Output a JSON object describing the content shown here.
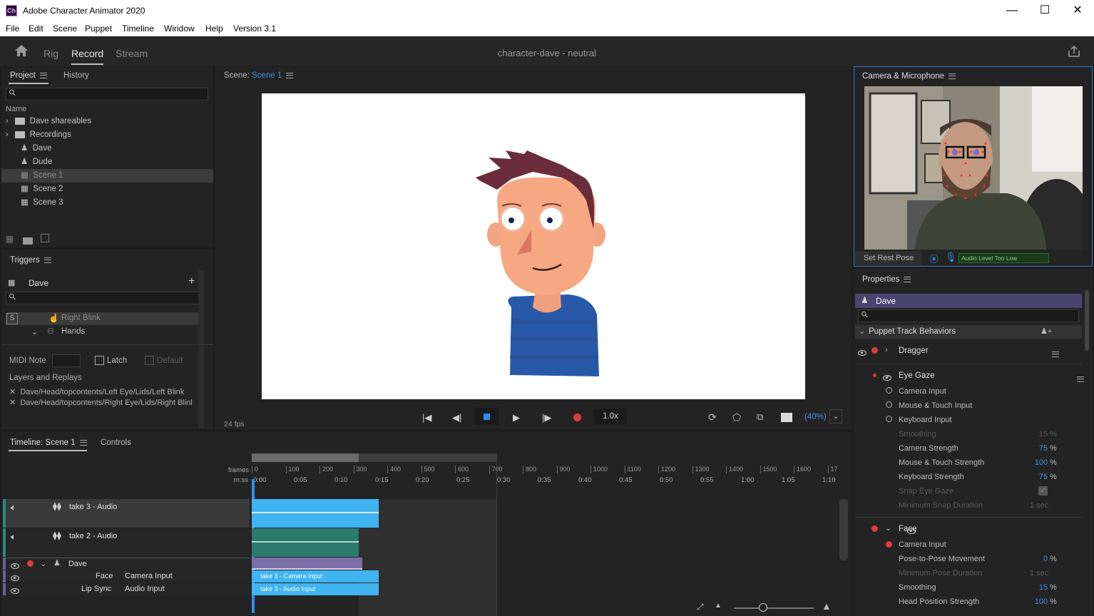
{
  "window": {
    "app_icon": "Ch",
    "title": "Adobe Character Animator 2020"
  },
  "menu": [
    "File",
    "Edit",
    "Scene",
    "Puppet",
    "Timeline",
    "Window",
    "Help",
    "Version 3.1"
  ],
  "workspace": {
    "tabs": [
      "Rig",
      "Record",
      "Stream"
    ],
    "active_tab": "Record",
    "document_title": "character-dave - neutral"
  },
  "project": {
    "tabs": [
      "Project",
      "History"
    ],
    "column_header": "Name",
    "items": [
      {
        "label": "Dave shareables",
        "type": "folder",
        "expandable": true
      },
      {
        "label": "Recordings",
        "type": "folder",
        "expandable": true
      },
      {
        "label": "Dave",
        "type": "puppet"
      },
      {
        "label": "Dude",
        "type": "puppet"
      },
      {
        "label": "Scene 1",
        "type": "scene",
        "selected": true
      },
      {
        "label": "Scene 2",
        "type": "scene"
      },
      {
        "label": "Scene 3",
        "type": "scene"
      }
    ]
  },
  "triggers": {
    "title": "Triggers",
    "puppet": "Dave",
    "items": [
      {
        "key": "S",
        "label": "Right Blink"
      },
      {
        "label": "Hands"
      }
    ],
    "midi_note_label": "MIDI Note",
    "latch_label": "Latch",
    "default_label": "Default",
    "layers_title": "Layers and Replays",
    "layers": [
      "Dave/Head/topcontents/Left Eye/Lids/Left Blink",
      "Dave/Head/topcontents/Right Eye/Lids/Right Blinl"
    ]
  },
  "scene": {
    "label": "Scene:",
    "name": "Scene 1",
    "fps": "24 fps",
    "speed": "1.0x",
    "zoom": "(40%)"
  },
  "camera": {
    "title": "Camera & Microphone",
    "set_rest_pose": "Set Rest Pose",
    "audio_level": "Audio Level Too Low"
  },
  "properties": {
    "title": "Properties",
    "puppet": "Dave",
    "section": "Puppet Track Behaviors",
    "behaviors": [
      {
        "name": "Dragger",
        "expanded": false
      },
      {
        "name": "Eye Gaze",
        "expanded": true,
        "inputs": [
          "Camera Input",
          "Mouse & Touch Input",
          "Keyboard Input"
        ],
        "params": [
          {
            "label": "Smoothing",
            "value": "15",
            "unit": "%",
            "disabled": true
          },
          {
            "label": "Camera Strength",
            "value": "75",
            "unit": "%"
          },
          {
            "label": "Mouse & Touch Strength",
            "value": "100",
            "unit": "%"
          },
          {
            "label": "Keyboard Strength",
            "value": "75",
            "unit": "%"
          },
          {
            "label": "Snap Eye Gaze",
            "value": "",
            "unit": "",
            "disabled": true,
            "checkbox": true
          },
          {
            "label": "Minimum Snap Duration",
            "value": "1",
            "unit": "sec",
            "disabled": true
          }
        ]
      },
      {
        "name": "Face",
        "expanded": true,
        "inputs": [
          "Camera Input"
        ],
        "params": [
          {
            "label": "Pose-to-Pose Movement",
            "value": "0",
            "unit": "%"
          },
          {
            "label": "Minimum Pose Duration",
            "value": "1",
            "unit": "sec",
            "disabled": true
          },
          {
            "label": "Smoothing",
            "value": "15",
            "unit": "%"
          },
          {
            "label": "Head Position Strength",
            "value": "100",
            "unit": "%"
          }
        ]
      }
    ]
  },
  "timeline": {
    "tabs": [
      "Timeline: Scene 1",
      "Controls"
    ],
    "frames_label": "frames",
    "mss_label": "m:ss",
    "frame_ticks": [
      "0",
      "100",
      "200",
      "300",
      "400",
      "500",
      "600",
      "700",
      "800",
      "900",
      "1000",
      "1100",
      "1200",
      "1300",
      "1400",
      "1500",
      "1600",
      "17"
    ],
    "time_ticks": [
      "0:00",
      "0:05",
      "0:10",
      "0:15",
      "0:20",
      "0:25",
      "0:30",
      "0:35",
      "0:40",
      "0:45",
      "0:50",
      "0:55",
      "1:00",
      "1:05",
      "1:10"
    ],
    "tracks": [
      {
        "label": "take 3 - Audio"
      },
      {
        "label": "take 2 - Audio"
      }
    ],
    "puppet_track": "Dave",
    "behavior_rows": [
      {
        "behavior": "Face",
        "input": "Camera Input",
        "clip": "take 3 - Camera Input"
      },
      {
        "behavior": "Lip Sync",
        "input": "Audio Input",
        "clip": "take 3 - Audio Input"
      }
    ]
  }
}
